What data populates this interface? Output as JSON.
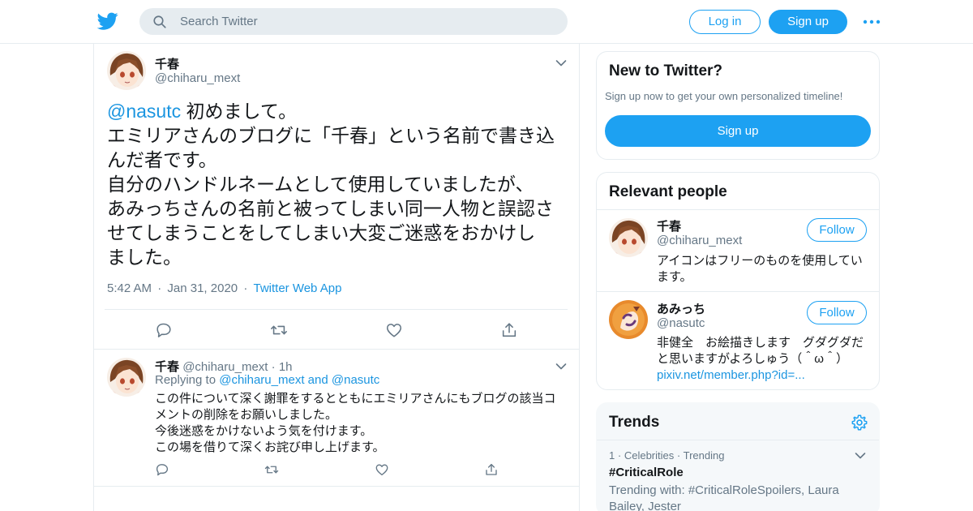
{
  "header": {
    "search_placeholder": "Search Twitter",
    "login_label": "Log in",
    "signup_label": "Sign up"
  },
  "tweet": {
    "name": "千春",
    "handle": "@chiharu_mext",
    "mention": "@nasutc",
    "lines": [
      "初めまして。",
      "エミリアさんのブログに「千春」という名前で書き込",
      "んだ者です。",
      "自分のハンドルネームとして使用していましたが、",
      "あみっちさんの名前と被ってしまい同一人物と誤認さ",
      "せてしまうことをしてしまい大変ご迷惑をおかけし",
      "ました。"
    ],
    "time": "5:42 AM",
    "date": "Jan 31, 2020",
    "source": "Twitter Web App",
    "sep": "·"
  },
  "reply": {
    "name": "千春",
    "handle": "@chiharu_mext",
    "age": "1h",
    "sep": "·",
    "replying_prefix": "Replying to",
    "replying_user1": "@chiharu_mext",
    "replying_and": "and",
    "replying_user2": "@nasutc",
    "lines": [
      "この件について深く謝罪をするとともにエミリアさんにもブログの該当コ",
      "メントの削除をお願いしました。",
      "今後迷惑をかけないよう気を付けます。",
      "この場を借りて深くお詫び申し上げます。"
    ]
  },
  "new_to_twitter": {
    "title": "New to Twitter?",
    "subtitle": "Sign up now to get your own personalized timeline!",
    "button": "Sign up"
  },
  "relevant_people": {
    "title": "Relevant people",
    "people": [
      {
        "name": "千春",
        "handle": "@chiharu_mext",
        "follow": "Follow",
        "bio_lines": [
          "アイコンはフリーのものを使用してい",
          "ます。"
        ],
        "link": ""
      },
      {
        "name": "あみっち",
        "handle": "@nasutc",
        "follow": "Follow",
        "bio_lines": [
          "非健全　お絵描きします　グダグダだ",
          "と思いますがよろしゅう（＾ω＾）"
        ],
        "link": "pixiv.net/member.php?id=..."
      }
    ]
  },
  "trends": {
    "title": "Trends",
    "items": [
      {
        "rank": "1",
        "category": "Celebrities",
        "status": "Trending",
        "sep": "·",
        "tag": "#CriticalRole",
        "with_lines": [
          "Trending with: #CriticalRoleSpoilers, Laura",
          "Bailey, Jester"
        ]
      }
    ]
  },
  "colors": {
    "accent": "#1da1f2",
    "link": "#1b95e0",
    "muted": "#657786",
    "border": "#e6ecf0"
  },
  "icons": [
    "twitter-bird-icon",
    "search-icon",
    "more-dots-icon",
    "chevron-down-icon",
    "reply-icon",
    "retweet-icon",
    "like-icon",
    "share-icon",
    "gear-icon"
  ]
}
